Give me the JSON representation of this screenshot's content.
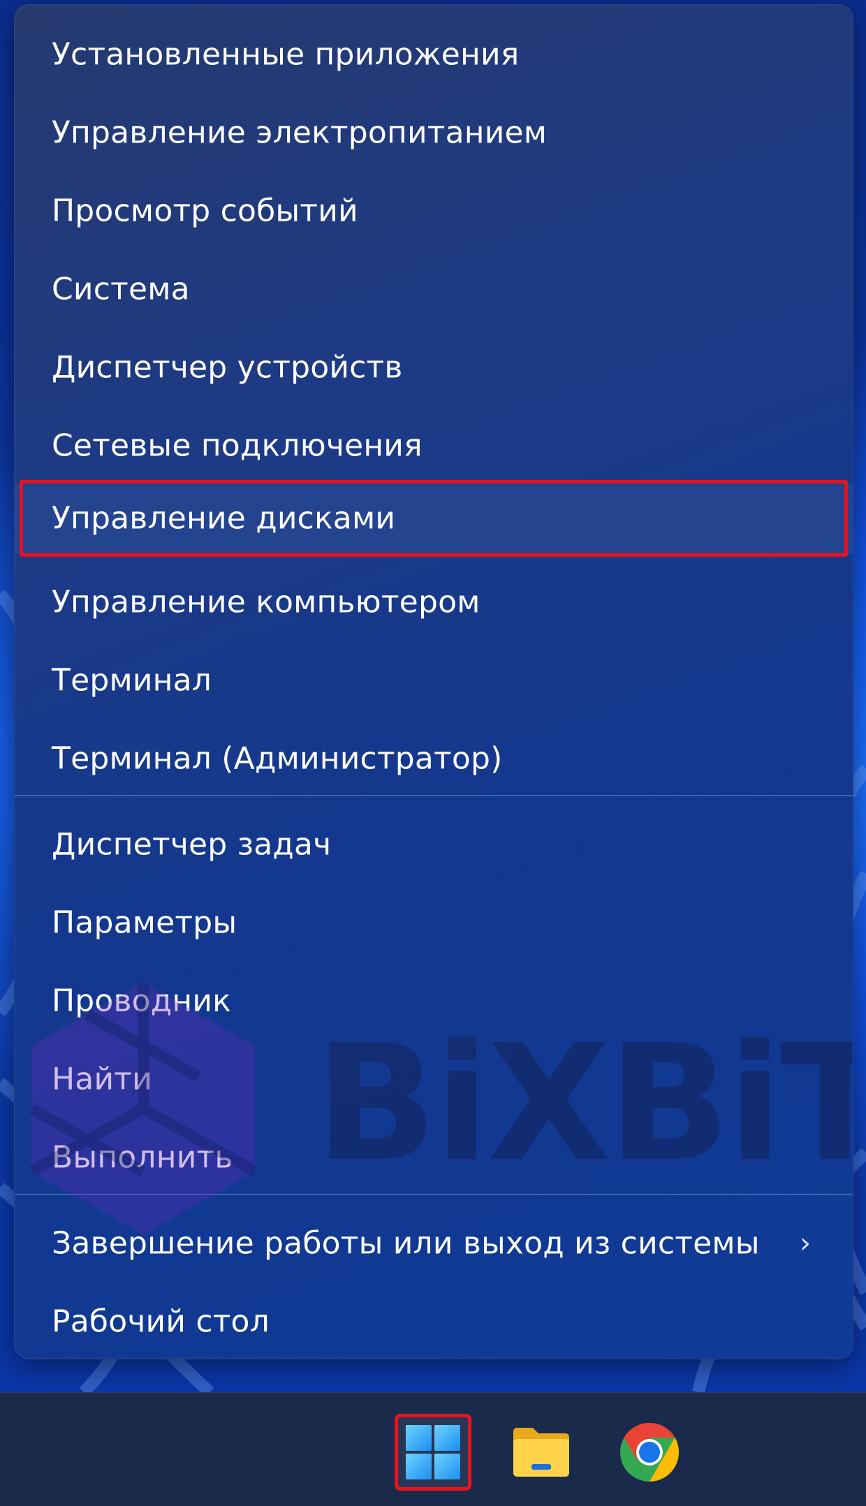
{
  "menu": {
    "items": [
      {
        "label": "Установленные приложения"
      },
      {
        "label": "Управление электропитанием"
      },
      {
        "label": "Просмотр событий"
      },
      {
        "label": "Система"
      },
      {
        "label": "Диспетчер устройств"
      },
      {
        "label": "Сетевые подключения"
      },
      {
        "label": "Управление дисками"
      },
      {
        "label": "Управление компьютером"
      },
      {
        "label": "Терминал"
      },
      {
        "label": "Терминал (Администратор)"
      },
      {
        "label": "Диспетчер задач"
      },
      {
        "label": "Параметры"
      },
      {
        "label": "Проводник"
      },
      {
        "label": "Найти"
      },
      {
        "label": "Выполнить"
      },
      {
        "label": "Завершение работы или выход из системы",
        "submenu_icon": "chevron-right-icon"
      },
      {
        "label": "Рабочий стол"
      }
    ],
    "highlighted_item": "Управление дисками"
  },
  "watermark": {
    "text": "BiXBiT"
  },
  "taskbar": {
    "icons": [
      "windows-start-icon",
      "file-explorer-icon",
      "chrome-icon"
    ]
  },
  "colors": {
    "highlight_frame": "#e8121f",
    "menu_background": "#1d3a85",
    "taskbar": "#1a2a4a"
  }
}
